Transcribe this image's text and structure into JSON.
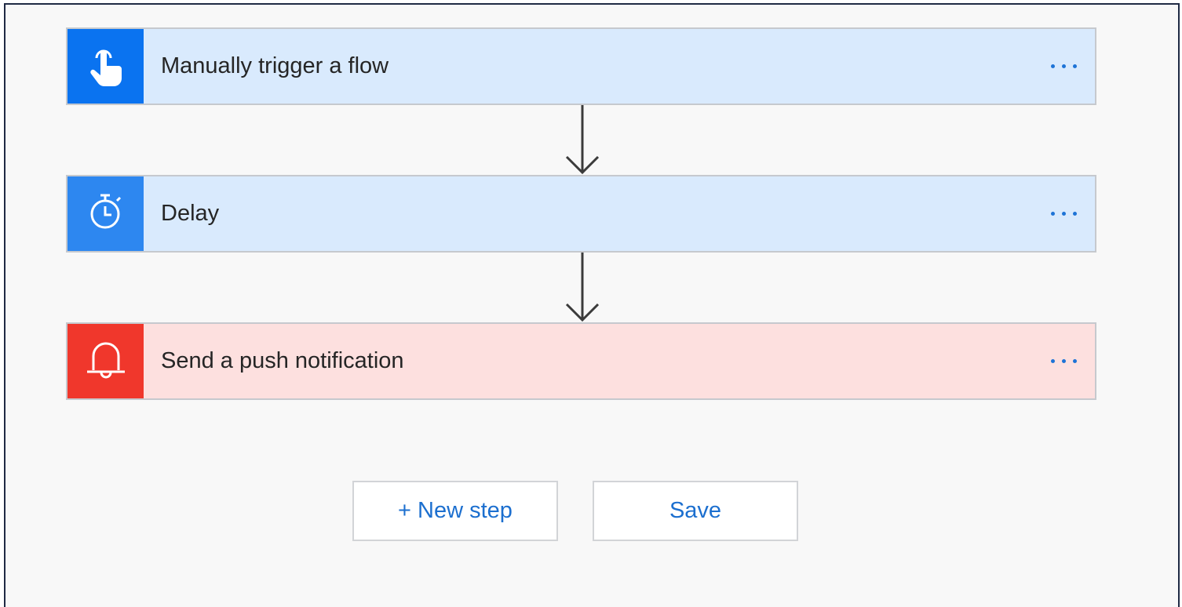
{
  "steps": [
    {
      "title": "Manually trigger a flow",
      "icon": "touch-hand-icon",
      "color": "#0a73f0"
    },
    {
      "title": "Delay",
      "icon": "stopwatch-icon",
      "color": "#2d87f0"
    },
    {
      "title": "Send a push notification",
      "icon": "bell-icon",
      "color": "#f0372c"
    }
  ],
  "actions": {
    "new_step_label": "+ New step",
    "save_label": "Save"
  },
  "colors": {
    "accent_link": "#1c6fcf",
    "card_blue_bg": "#d9eafd",
    "card_red_bg": "#fde0df",
    "canvas_bg": "#f8f8f8"
  }
}
